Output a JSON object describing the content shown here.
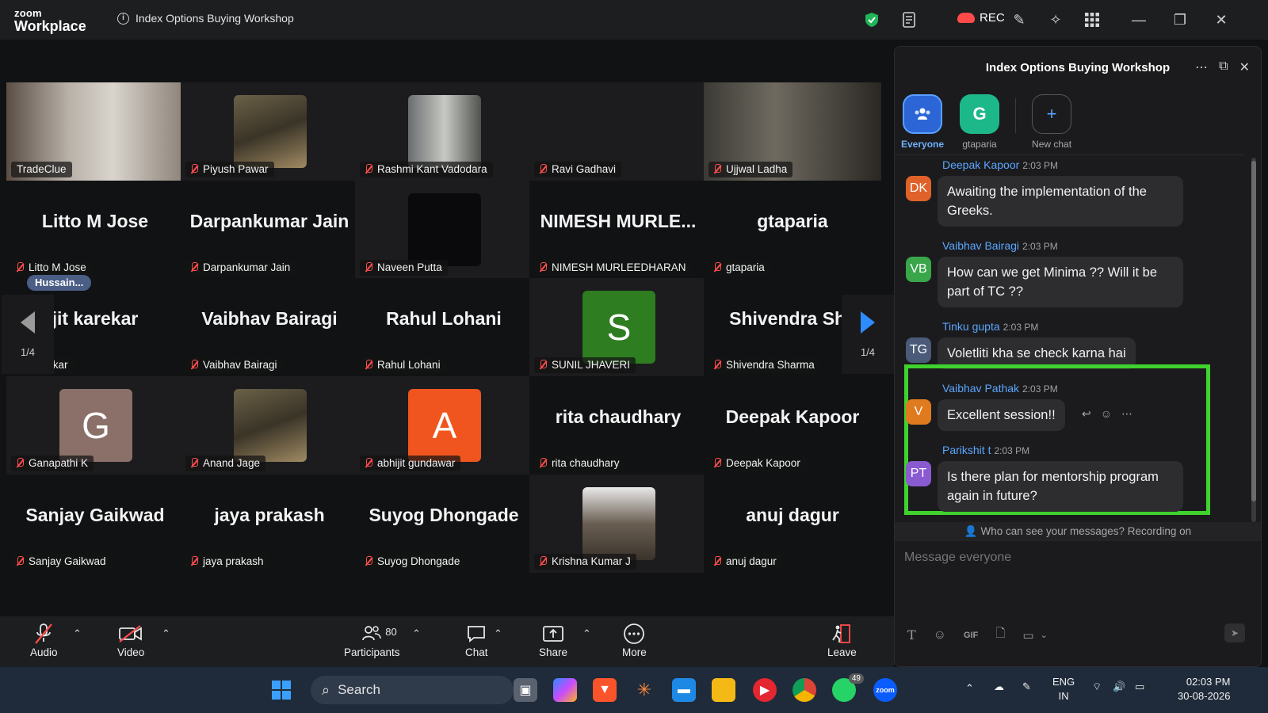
{
  "app": {
    "brand_line1": "zoom",
    "brand_line2": "Workplace",
    "meeting_title": "Index Options Buying Workshop",
    "rec_label": "REC"
  },
  "grid": {
    "page_indicator": "1/4",
    "hussain_tag": "Hussain...",
    "tiles": [
      {
        "big": "",
        "label": "TradeClue",
        "muted": false,
        "kind": "video"
      },
      {
        "big": "",
        "label": "Piyush Pawar",
        "muted": true,
        "kind": "photo"
      },
      {
        "big": "",
        "label": "Rashmi Kant Vadodara",
        "muted": true,
        "kind": "photo"
      },
      {
        "big": "",
        "label": "Ravi Gadhavi",
        "muted": true,
        "kind": "blank"
      },
      {
        "big": "",
        "label": "Ujjwal Ladha",
        "muted": true,
        "kind": "video"
      },
      {
        "big": "Litto M Jose",
        "label": "Litto M Jose",
        "muted": true,
        "kind": "name"
      },
      {
        "big": "Darpankumar Jain",
        "label": "Darpankumar Jain",
        "muted": true,
        "kind": "name"
      },
      {
        "big": "",
        "label": "Naveen Putta",
        "muted": true,
        "kind": "dark"
      },
      {
        "big": "NIMESH MURLE...",
        "label": "NIMESH MURLEEDHARAN",
        "muted": true,
        "kind": "name"
      },
      {
        "big": "gtaparia",
        "label": "gtaparia",
        "muted": true,
        "kind": "name"
      },
      {
        "big": "jit karekar",
        "label": "...arekar",
        "muted": true,
        "kind": "name"
      },
      {
        "big": "Vaibhav Bairagi",
        "label": "Vaibhav Bairagi",
        "muted": true,
        "kind": "name"
      },
      {
        "big": "Rahul Lohani",
        "label": "Rahul Lohani",
        "muted": true,
        "kind": "name"
      },
      {
        "big": "S",
        "label": "SUNIL JHAVERI",
        "muted": true,
        "kind": "letter",
        "color": "#2e7d20"
      },
      {
        "big": "Shivendra Sha",
        "label": "Shivendra Sharma",
        "muted": true,
        "kind": "name"
      },
      {
        "big": "G",
        "label": "Ganapathi K",
        "muted": true,
        "kind": "letter",
        "color": "#8a7068"
      },
      {
        "big": "",
        "label": "Anand Jage",
        "muted": true,
        "kind": "photo"
      },
      {
        "big": "A",
        "label": "abhijit gundawar",
        "muted": true,
        "kind": "letter",
        "color": "#f0551f"
      },
      {
        "big": "rita chaudhary",
        "label": "rita chaudhary",
        "muted": true,
        "kind": "name"
      },
      {
        "big": "Deepak Kapoor",
        "label": "Deepak Kapoor",
        "muted": true,
        "kind": "name"
      },
      {
        "big": "Sanjay Gaikwad",
        "label": "Sanjay Gaikwad",
        "muted": true,
        "kind": "name"
      },
      {
        "big": "jaya prakash",
        "label": "jaya prakash",
        "muted": true,
        "kind": "name"
      },
      {
        "big": "Suyog Dhongade",
        "label": "Suyog Dhongade",
        "muted": true,
        "kind": "name"
      },
      {
        "big": "",
        "label": "Krishna Kumar J",
        "muted": true,
        "kind": "photo"
      },
      {
        "big": "anuj dagur",
        "label": "anuj dagur",
        "muted": true,
        "kind": "name"
      }
    ]
  },
  "toolbar": {
    "audio": "Audio",
    "video": "Video",
    "participants": "Participants",
    "participants_count": "80",
    "chat": "Chat",
    "share": "Share",
    "more": "More",
    "leave": "Leave"
  },
  "chat": {
    "title": "Index Options Buying Workshop",
    "recipients": [
      {
        "label": "Everyone",
        "glyph": "",
        "selected": true
      },
      {
        "label": "gtaparia",
        "glyph": "G",
        "selected": false
      },
      {
        "label": "New chat",
        "glyph": "+",
        "selected": false
      }
    ],
    "messages": [
      {
        "initials": "DK",
        "color": "#e0622a",
        "sender": "Deepak Kapoor",
        "time": "2:03 PM",
        "text": "Awaiting the implementation of the Greeks."
      },
      {
        "initials": "VB",
        "color": "#3aa64a",
        "sender": "Vaibhav Bairagi",
        "time": "2:03 PM",
        "text": "How can we get Minima ?? Will it be part of TC ??"
      },
      {
        "initials": "TG",
        "color": "#4a5a78",
        "sender": "Tinku gupta",
        "time": "2:03 PM",
        "text": "Voletliti kha se check karna hai"
      },
      {
        "initials": "V",
        "color": "#e07a1f",
        "sender": "Vaibhav Pathak",
        "time": "2:03 PM",
        "text": "Excellent session!!"
      },
      {
        "initials": "PT",
        "color": "#8a5ad0",
        "sender": "Parikshit t",
        "time": "2:03 PM",
        "text": "Is there plan for mentorship program again in future?"
      }
    ],
    "privacy_note": "Who can see your messages? Recording on",
    "input_placeholder": "Message everyone",
    "gif_label": "GIF"
  },
  "taskbar": {
    "search_label": "Search",
    "lang_line1": "ENG",
    "lang_line2": "IN",
    "time": "02:03 PM",
    "date": "30-08-2026",
    "whatsapp_badge": "49"
  }
}
